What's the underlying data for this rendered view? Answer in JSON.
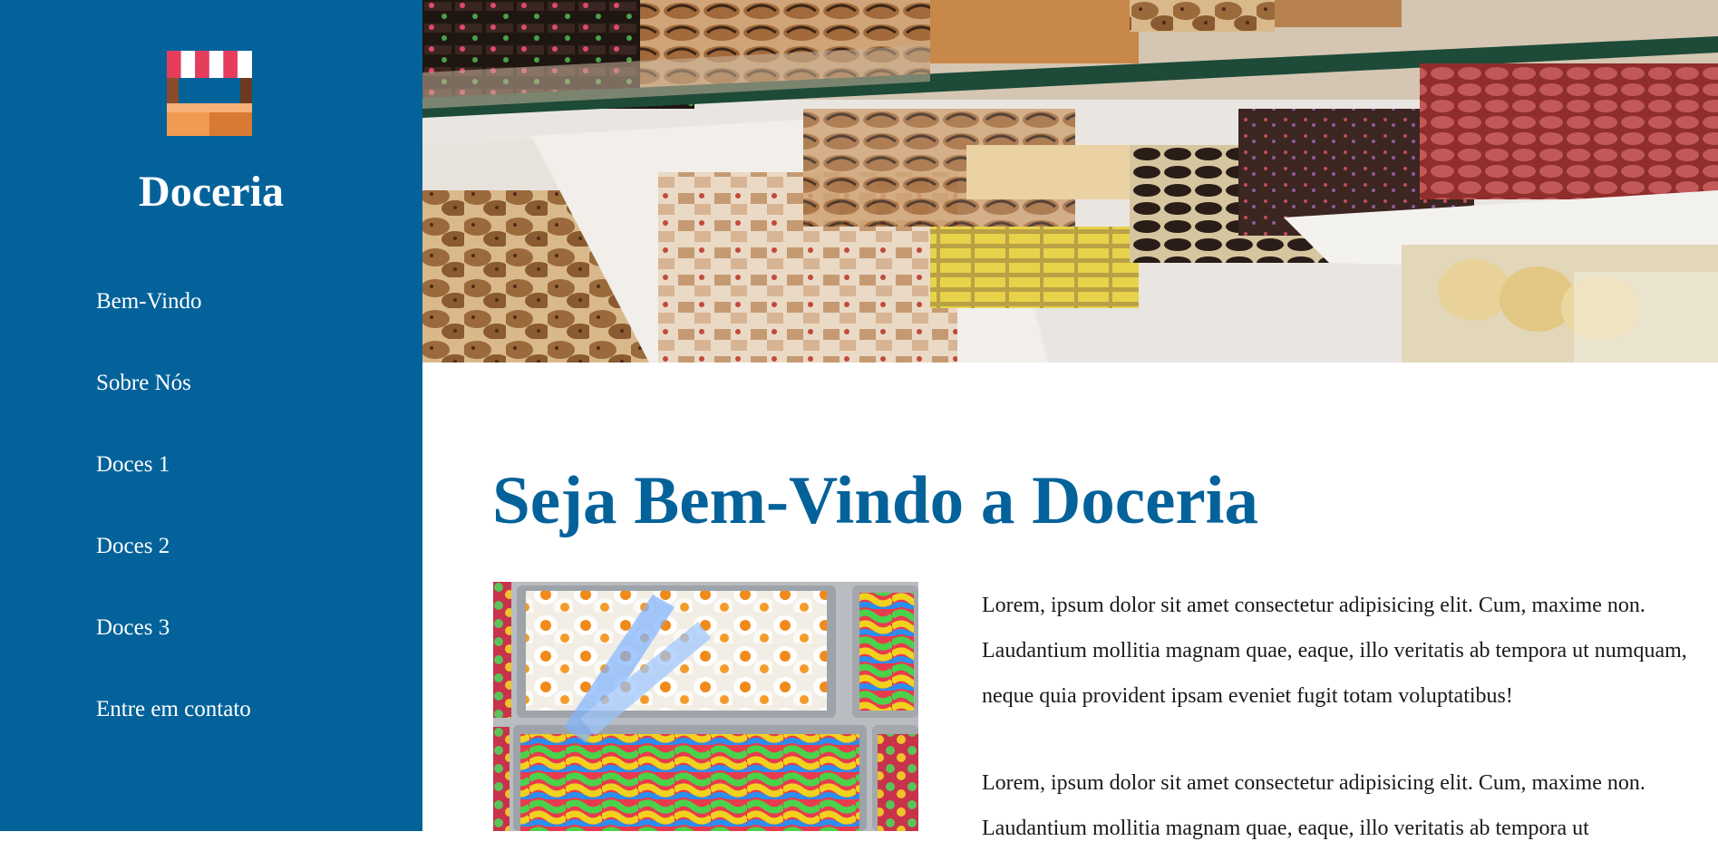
{
  "brand": {
    "name": "Doceria",
    "logo_icon": "candy-stall-awning-icon"
  },
  "nav": {
    "items": [
      {
        "label": "Bem-Vindo"
      },
      {
        "label": "Sobre Nós"
      },
      {
        "label": "Doces 1"
      },
      {
        "label": "Doces 2"
      },
      {
        "label": "Doces 3"
      },
      {
        "label": "Entre em contato"
      }
    ]
  },
  "main": {
    "title": "Seja Bem-Vindo a Doceria",
    "paragraphs": [
      "Lorem, ipsum dolor sit amet consectetur adipisicing elit. Cum, maxime non. Laudantium mollitia magnam quae, eaque, illo veritatis ab tempora ut numquam, neque quia provident ipsam eveniet fugit totam voluptatibus!",
      "Lorem, ipsum dolor sit amet consectetur adipisicing elit. Cum, maxime non. Laudantium mollitia magnam quae, eaque, illo veritatis ab tempora ut"
    ]
  },
  "colors": {
    "primary": "#03629a",
    "text": "#1a1a1a",
    "background": "#ffffff"
  }
}
